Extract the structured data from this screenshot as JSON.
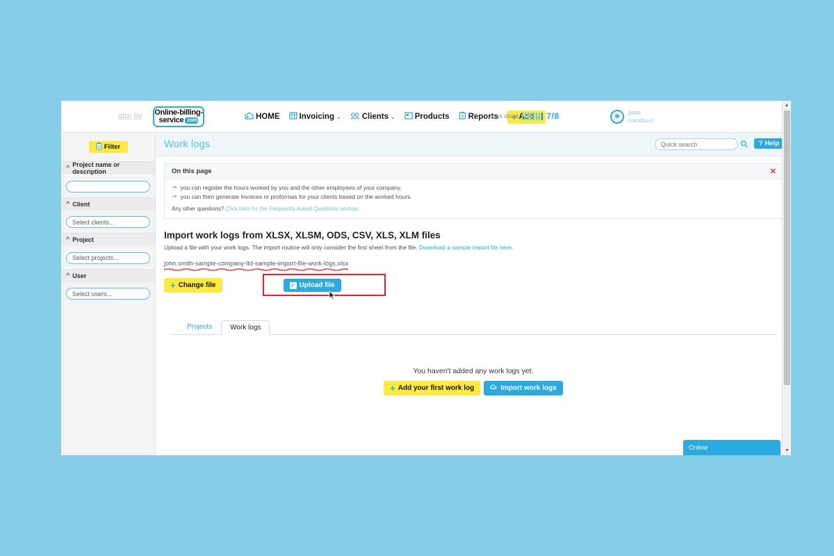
{
  "brand": {
    "app_by": "app by",
    "logo_line1": "Online-billing-",
    "logo_line2": "service",
    "logo_tld": ".com"
  },
  "topnav": {
    "items": [
      {
        "label": "HOME",
        "icon": "home-icon",
        "caret": ""
      },
      {
        "label": "Invoicing",
        "icon": "invoicing-icon",
        "caret": "⌄"
      },
      {
        "label": "Clients",
        "icon": "clients-icon",
        "caret": "⌄"
      },
      {
        "label": "Products",
        "icon": "products-icon",
        "caret": ""
      },
      {
        "label": "Reports",
        "icon": "reports-icon",
        "caret": ""
      }
    ],
    "add_label": "Add",
    "add_caret": "⌄"
  },
  "steps": {
    "label": "steps done",
    "count": "7/8",
    "filled": 7,
    "total": 8
  },
  "user": {
    "name": "John",
    "sub": "(sandbox)",
    "avatar_icon": "user-avatar-icon"
  },
  "sidebar": {
    "filter_label": "Filter",
    "filter_icon": "clipboard-icon",
    "sections": [
      {
        "title": "Project name or description",
        "placeholder": "",
        "value": ""
      },
      {
        "title": "Client",
        "placeholder": "Select clients...",
        "value": ""
      },
      {
        "title": "Project",
        "placeholder": "Select projects...",
        "value": ""
      },
      {
        "title": "User",
        "placeholder": "Select users...",
        "value": ""
      }
    ]
  },
  "header": {
    "page_title": "Work logs",
    "search_placeholder": "Quick search",
    "search_value": "",
    "search_icon": "magnifier-icon",
    "help_label": "Help",
    "help_icon": "question-mark-icon"
  },
  "infobox": {
    "title": "On this page",
    "close_icon": "close-x-icon",
    "bullets": [
      "you can register the hours worked by you and the other employees of your company.",
      "you can then generate invoices or proformas for your clients based on the worked hours."
    ],
    "faq_prefix": "Any other questions? ",
    "faq_link": "Click here for the Frequently Asked Questions section",
    "faq_suffix": "."
  },
  "import": {
    "title": "Import work logs from XLSX, XLSM, ODS, CSV, XLS, XLM files",
    "subtitle": "Upload a file with your work logs. The import routine will only consider the first sheet from the file. ",
    "sample_link": "Download a sample import file here",
    "subtitle_suffix": ".",
    "filename": "john.smith-sample-company-ltd-sample-import-file-work-logs.xlsx",
    "change_label": "Change file",
    "change_icon": "plus-icon",
    "upload_label": "Upload file",
    "upload_icon": "checkbox-icon",
    "highlight_color": "#ee1c24"
  },
  "tabs": [
    {
      "label": "Projects",
      "active": false
    },
    {
      "label": "Work logs",
      "active": true
    }
  ],
  "empty_state": {
    "text": "You haven't added any work logs yet.",
    "add_label": "Add your first work log",
    "add_icon": "plus-icon",
    "import_label": "Import work logs",
    "import_icon": "import-icon"
  },
  "chat": {
    "label": "Online",
    "caret_icon": "chevron-down-icon"
  },
  "colors": {
    "brand_blue": "#29abe2",
    "accent_yellow": "#ffe93d",
    "page_background": "#85cde8",
    "highlight_red": "#ee1c24"
  }
}
